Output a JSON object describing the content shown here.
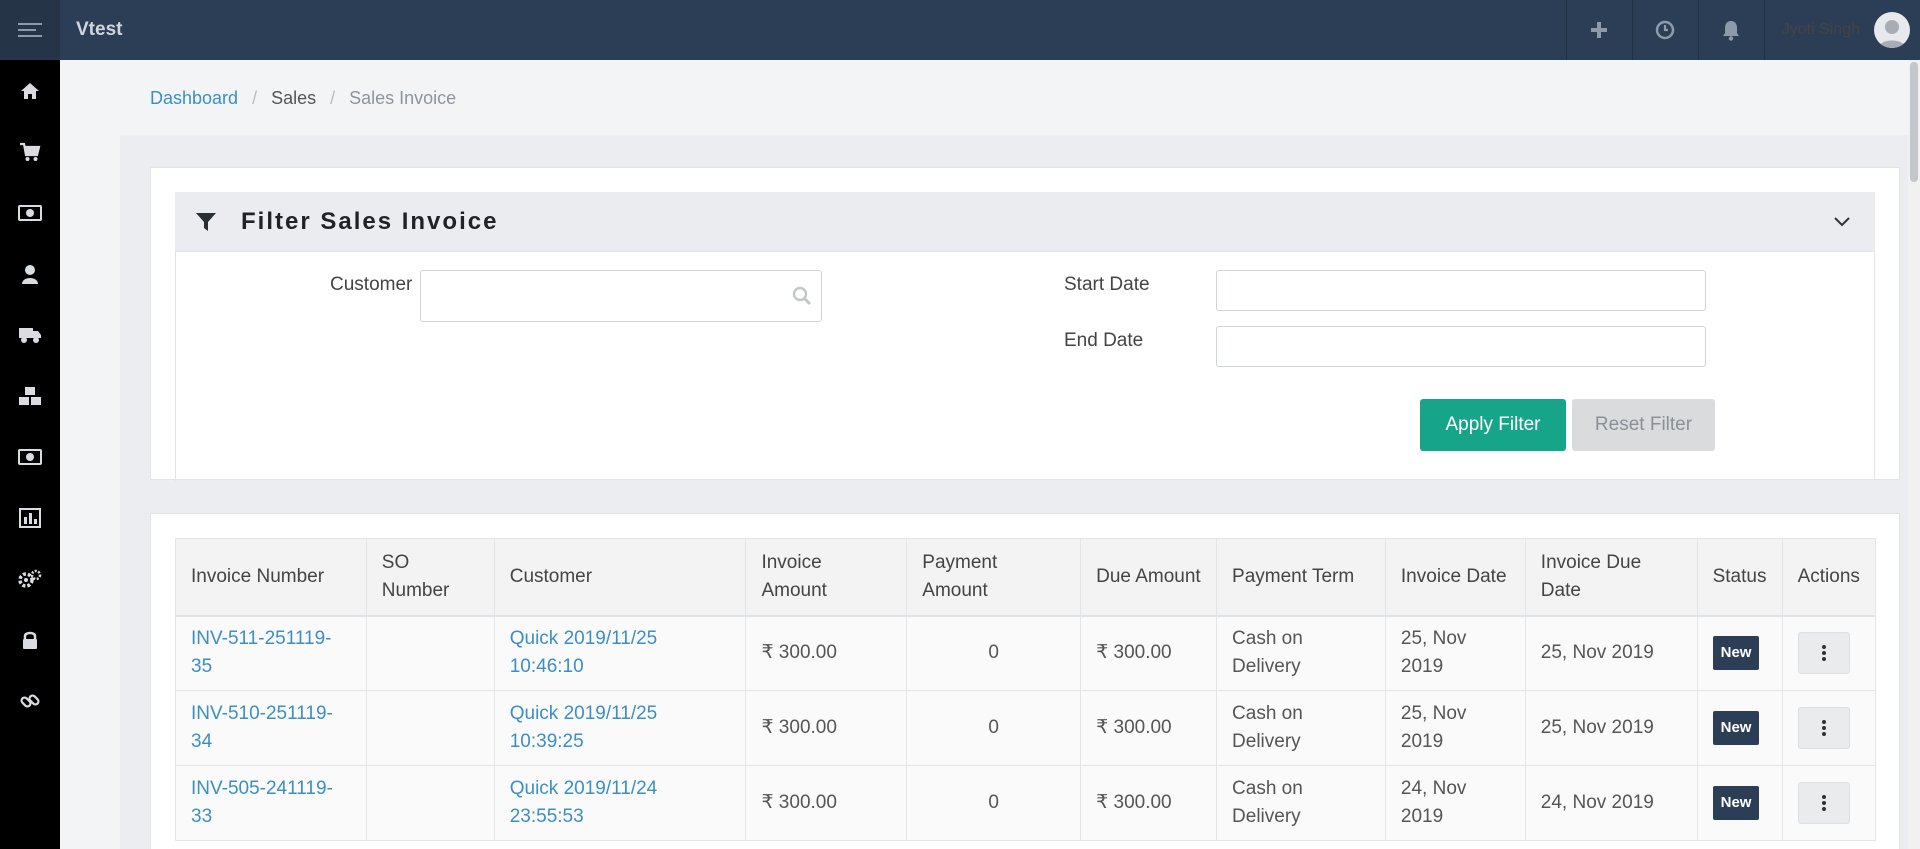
{
  "app": {
    "brand": "Vtest"
  },
  "header": {
    "icons": [
      "plus-icon",
      "clock-icon",
      "bell-icon"
    ],
    "user_name": "Jyoti Singh"
  },
  "sidebar": {
    "items": [
      "home-icon",
      "cart-icon",
      "money-icon",
      "user-icon",
      "truck-icon",
      "cubes-icon",
      "money-icon",
      "bar-chart-icon",
      "gears-icon",
      "lock-icon",
      "link-icon"
    ]
  },
  "breadcrumb": {
    "home": "Dashboard",
    "section": "Sales",
    "current": "Sales Invoice"
  },
  "filter": {
    "title": "Filter Sales Invoice",
    "customer_label": "Customer",
    "customer_value": "",
    "start_label": "Start Date",
    "start_value": "",
    "end_label": "End Date",
    "end_value": "",
    "apply_label": "Apply Filter",
    "reset_label": "Reset Filter"
  },
  "table": {
    "headers": {
      "invoice_number": "Invoice Number",
      "so_number": "SO Number",
      "customer": "Customer",
      "invoice_amount": "Invoice Amount",
      "payment_amount": "Payment Amount",
      "due_amount": "Due Amount",
      "payment_term": "Payment Term",
      "invoice_date": "Invoice Date",
      "invoice_due_date": "Invoice Due Date",
      "status": "Status",
      "actions": "Actions"
    },
    "rows": [
      {
        "invoice_number": "INV-511-251119-35",
        "so_number": "",
        "customer": "Quick 2019/11/25 10:46:10",
        "invoice_amount": "₹ 300.00",
        "payment_amount": "0",
        "due_amount": "₹ 300.00",
        "payment_term": "Cash on Delivery",
        "invoice_date": "25, Nov 2019",
        "invoice_due_date": "25, Nov 2019",
        "status": "New"
      },
      {
        "invoice_number": "INV-510-251119-34",
        "so_number": "",
        "customer": "Quick 2019/11/25 10:39:25",
        "invoice_amount": "₹ 300.00",
        "payment_amount": "0",
        "due_amount": "₹ 300.00",
        "payment_term": "Cash on Delivery",
        "invoice_date": "25, Nov 2019",
        "invoice_due_date": "25, Nov 2019",
        "status": "New"
      },
      {
        "invoice_number": "INV-505-241119-33",
        "so_number": "",
        "customer": "Quick 2019/11/24 23:55:53",
        "invoice_amount": "₹ 300.00",
        "payment_amount": "0",
        "due_amount": "₹ 300.00",
        "payment_term": "Cash on Delivery",
        "invoice_date": "24, Nov 2019",
        "invoice_due_date": "24, Nov 2019",
        "status": "New"
      }
    ]
  },
  "colors": {
    "topbar": "#2c3e55",
    "sidebar": "#000000",
    "accent": "#17a589",
    "link": "#3b8fc4",
    "badge": "#2c3e55"
  }
}
